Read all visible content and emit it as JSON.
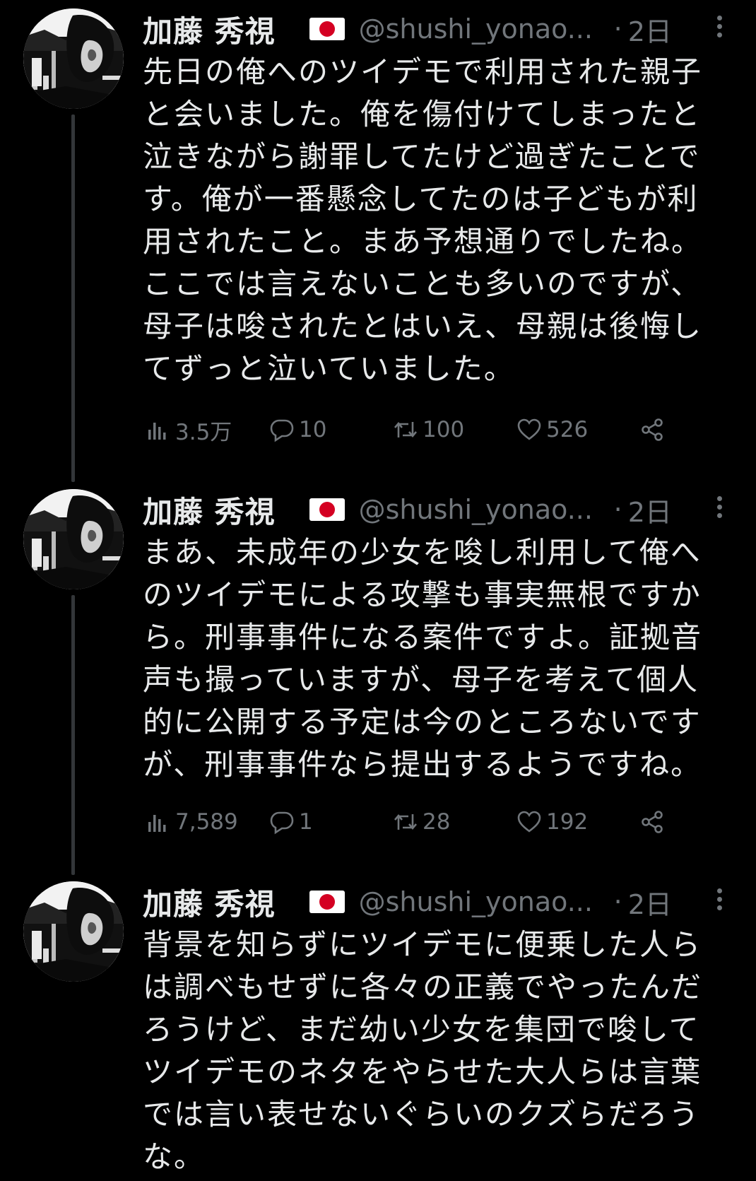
{
  "tweets": [
    {
      "author_name": "加藤 秀視",
      "handle": "@shushi_yonao...",
      "separator": "·",
      "time": "2日",
      "text": "先日の俺へのツイデモで利用された親子\nと会いました。俺を傷付けてしまったと\n泣きながら謝罪してたけど過ぎたことで\nす。俺が一番懸念してたのは子どもが利\n用されたこと。まあ予想通りでしたね。\nここでは言えないことも多いのですが、\n母子は唆されたとはいえ、母親は後悔し\nてずっと泣いていました。",
      "views": "3.5万",
      "replies": "10",
      "retweets": "100",
      "likes": "526"
    },
    {
      "author_name": "加藤 秀視",
      "handle": "@shushi_yonao...",
      "separator": "·",
      "time": "2日",
      "text": "まあ、未成年の少女を唆し利用して俺へ\nのツイデモによる攻撃も事実無根ですか\nら。刑事事件になる案件ですよ。証拠音\n声も撮っていますが、母子を考えて個人\n的に公開する予定は今のところないです\nが、刑事事件なら提出するようですね。",
      "views": "7,589",
      "replies": "1",
      "retweets": "28",
      "likes": "192"
    },
    {
      "author_name": "加藤 秀視",
      "handle": "@shushi_yonao...",
      "separator": "·",
      "time": "2日",
      "text": "背景を知らずにツイデモに便乗した人ら\nは調べもせずに各々の正義でやったんだ\nろうけど、まだ幼い少女を集団で唆して\nツイデモのネタをやらせた大人らは言葉\nでは言い表せないぐらいのクズらだろう\nな。"
    }
  ],
  "colors": {
    "background": "#000000",
    "text": "#e7e9ea",
    "secondary": "#71767b",
    "thread_line": "#333639"
  },
  "icons": [
    "japan-flag-icon",
    "more-icon",
    "views-icon",
    "reply-icon",
    "retweet-icon",
    "like-icon",
    "share-icon"
  ]
}
